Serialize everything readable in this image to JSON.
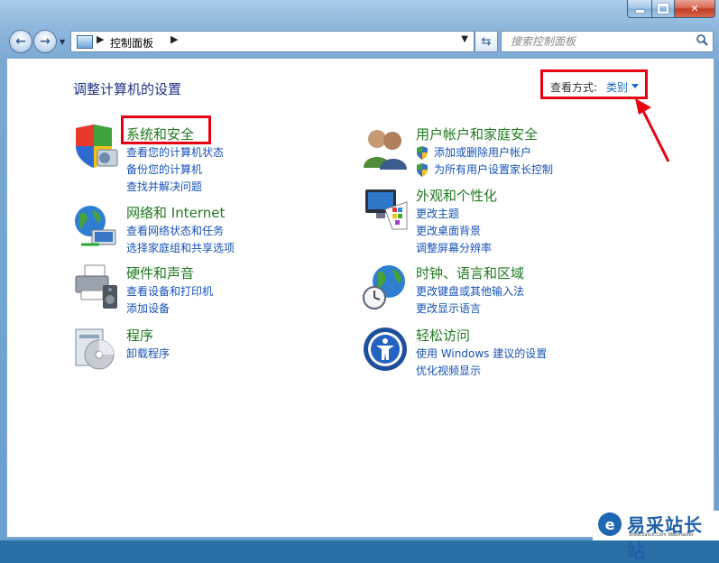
{
  "window": {
    "minimize_glyph": "",
    "maximize_glyph": "",
    "close_glyph": "✕"
  },
  "address_bar": {
    "crumbs": [
      "控制面板"
    ],
    "separator": "▶",
    "dropdown_glyph": "▼"
  },
  "search": {
    "placeholder": "搜索控制面板"
  },
  "page_title": "调整计算机的设置",
  "view_by": {
    "label": "查看方式:",
    "value": "类别"
  },
  "categories": [
    {
      "title": "系统和安全",
      "icon": "shield-computer-icon",
      "links": [
        "查看您的计算机状态",
        "备份您的计算机",
        "查找并解决问题"
      ]
    },
    {
      "title": "网络和 Internet",
      "icon": "network-globe-icon",
      "links": [
        "查看网络状态和任务",
        "选择家庭组和共享选项"
      ]
    },
    {
      "title": "硬件和声音",
      "icon": "printer-speaker-icon",
      "links": [
        "查看设备和打印机",
        "添加设备"
      ]
    },
    {
      "title": "程序",
      "icon": "programs-disc-icon",
      "links": [
        "卸载程序"
      ]
    },
    {
      "title": "用户帐户和家庭安全",
      "icon": "users-icon",
      "links": [
        "添加或删除用户帐户",
        "为所有用户设置家长控制"
      ]
    },
    {
      "title": "外观和个性化",
      "icon": "monitor-palette-icon",
      "links": [
        "更改主题",
        "更改桌面背景",
        "调整屏幕分辨率"
      ]
    },
    {
      "title": "时钟、语言和区域",
      "icon": "clock-globe-icon",
      "links": [
        "更改键盘或其他输入法",
        "更改显示语言"
      ]
    },
    {
      "title": "轻松访问",
      "icon": "ease-of-access-icon",
      "links": [
        "使用 Windows 建议的设置",
        "优化视频显示"
      ]
    }
  ],
  "watermark": {
    "logo": "e",
    "text": "易采站长站",
    "sub": "Www.Easck.Com Webmaster"
  },
  "colors": {
    "title_green": "#1f7a1f",
    "link_blue": "#1552b8",
    "highlight_red": "#e60012"
  }
}
